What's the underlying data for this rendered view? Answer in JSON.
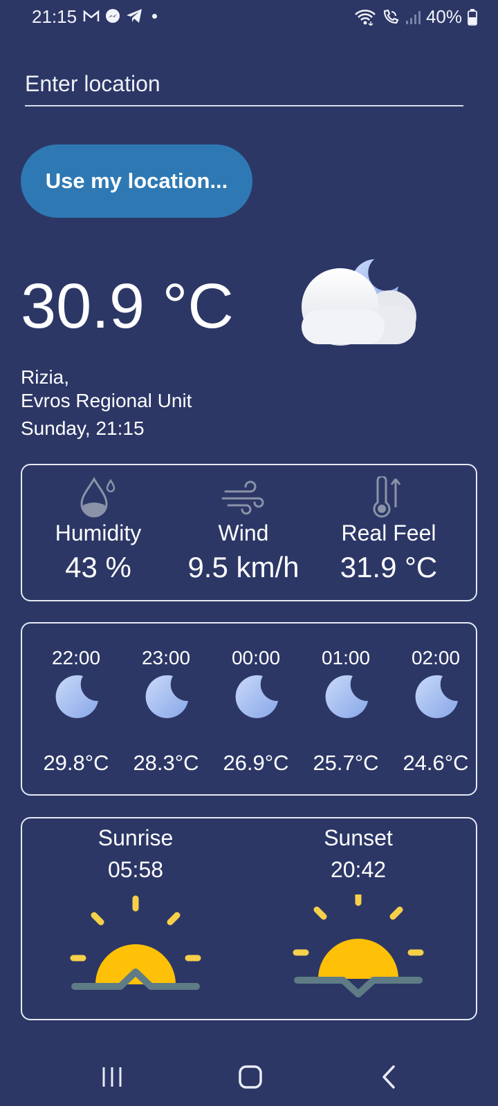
{
  "status_bar": {
    "time": "21:15",
    "battery": "40%",
    "icons_left": [
      "gmail-icon",
      "messenger-icon",
      "telegram-icon",
      "dot-icon"
    ],
    "icons_right": [
      "wifi-icon",
      "wifi-call-icon",
      "signal-icon",
      "battery-icon"
    ]
  },
  "search": {
    "placeholder": "Enter location",
    "value": ""
  },
  "use_location_label": "Use my location...",
  "current": {
    "temperature": "30.9 °C",
    "place_line1": "Rizia,",
    "place_line2": "Evros Regional Unit",
    "datetime": "Sunday, 21:15",
    "condition_icon": "cloud-moon-icon"
  },
  "metrics": [
    {
      "label": "Humidity",
      "value": "43 %",
      "icon": "humidity-icon"
    },
    {
      "label": "Wind",
      "value": "9.5 km/h",
      "icon": "wind-icon"
    },
    {
      "label": "Real Feel",
      "value": "31.9 °C",
      "icon": "thermometer-icon"
    }
  ],
  "hourly": [
    {
      "time": "22:00",
      "temp": "29.8°C",
      "icon": "moon-icon"
    },
    {
      "time": "23:00",
      "temp": "28.3°C",
      "icon": "moon-icon"
    },
    {
      "time": "00:00",
      "temp": "26.9°C",
      "icon": "moon-icon"
    },
    {
      "time": "01:00",
      "temp": "25.7°C",
      "icon": "moon-icon"
    },
    {
      "time": "02:00",
      "temp": "24.6°C",
      "icon": "moon-icon"
    }
  ],
  "sun": {
    "sunrise_label": "Sunrise",
    "sunrise_time": "05:58",
    "sunset_label": "Sunset",
    "sunset_time": "20:42"
  },
  "colors": {
    "background": "#2c3766",
    "button": "#2e79b4",
    "sun": "#ffc107",
    "moon": "#a9c4f2"
  },
  "nav": [
    "recents-icon",
    "home-icon",
    "back-icon"
  ]
}
